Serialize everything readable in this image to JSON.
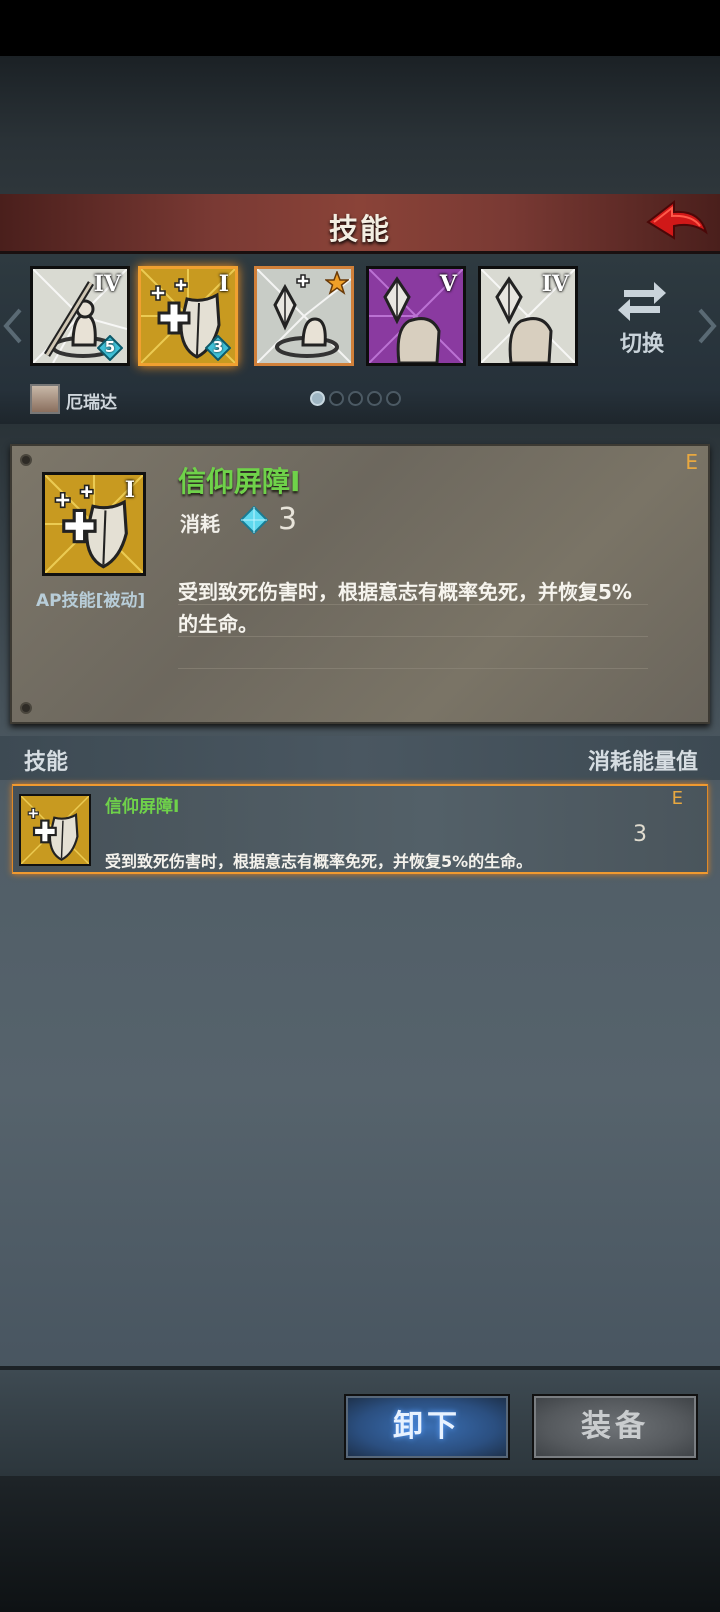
{
  "header": {
    "title": "技能",
    "back_icon": "red-arrow-back-icon"
  },
  "skill_bar": {
    "skills": [
      {
        "icon": "staff-priest-icon",
        "rank": "IV",
        "badge": "5",
        "bg": "#d9dad2"
      },
      {
        "icon": "shield-heal-icon",
        "rank": "I",
        "badge": "3",
        "bg": "#c89a20",
        "selected": true
      },
      {
        "icon": "crystal-priest-icon",
        "rank": "",
        "badge": "",
        "star": true,
        "bg": "#c8ccc6"
      },
      {
        "icon": "crystal-arm-icon",
        "rank": "V",
        "badge": "",
        "bg": "#8a3aa0"
      },
      {
        "icon": "crystal-arm-icon",
        "rank": "IV",
        "badge": "",
        "bg": "#d9dad2"
      }
    ],
    "switch_label": "切换",
    "character_name": "厄瑞达",
    "page_count": 5,
    "page_active": 1
  },
  "detail": {
    "rank": "E",
    "name": "信仰屏障Ⅰ",
    "icon_rank": "I",
    "type": "AP技能[被动]",
    "cost_label": "消耗",
    "cost_value": "3",
    "description": "受到致死伤害时，根据意志有概率免死，并恢复5%的生命。"
  },
  "list_header": {
    "left": "技能",
    "right": "消耗能量值"
  },
  "list": [
    {
      "name": "信仰屏障Ⅰ",
      "rank": "E",
      "cost": "3",
      "description": "受到致死伤害时，根据意志有概率免死，并恢复5%的生命。"
    }
  ],
  "buttons": {
    "unequip": "卸下",
    "equip": "装备"
  },
  "colors": {
    "skill_name": "#6fd24a",
    "rank": "#e8a840",
    "highlight": "#f09a30"
  }
}
